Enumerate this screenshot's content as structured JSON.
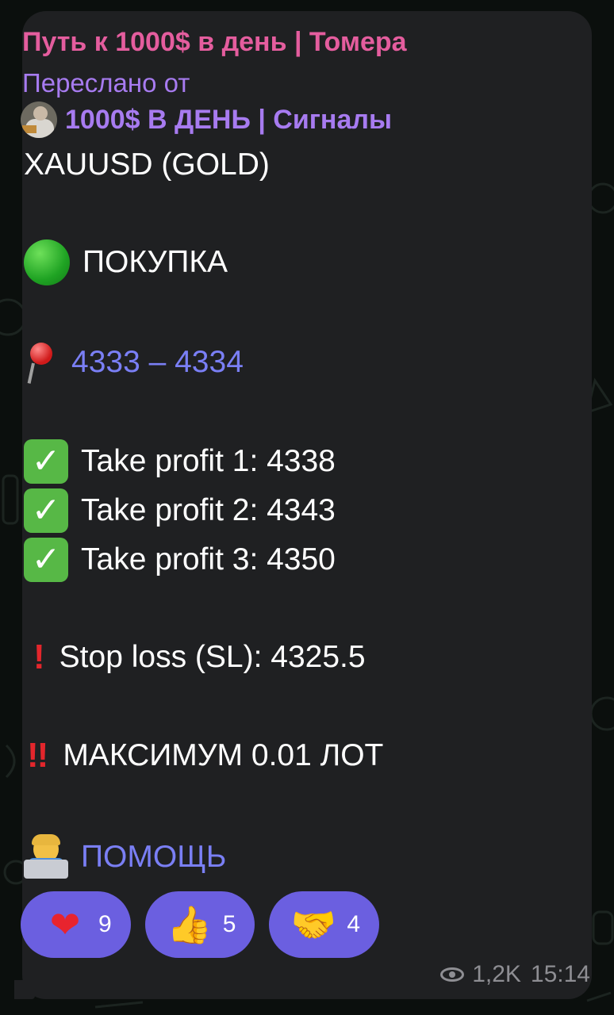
{
  "message": {
    "channel_title": "Путь к 1000$ в день | Томера",
    "forwarded_label": "Переслано от",
    "forwarded_source": "1000$ В ДЕНЬ | Сигналы",
    "instrument": "XAUUSD (GOLD)",
    "direction": "ПОКУПКА",
    "entry_range": "4333 – 4334",
    "take_profits": [
      "Take profit 1: 4338",
      "Take profit 2: 4343",
      "Take profit 3: 4350"
    ],
    "stop_loss": "Stop loss (SL): 4325.5",
    "max_lot": "МАКСИМУМ 0.01 ЛОТ",
    "help_link": "ПОМОЩЬ",
    "reactions": [
      {
        "icon": "heart-icon",
        "glyph": "❤",
        "count": "9"
      },
      {
        "icon": "thumbs-up-icon",
        "glyph": "👍",
        "count": "5"
      },
      {
        "icon": "handshake-icon",
        "glyph": "🤝",
        "count": "4"
      }
    ],
    "views": "1,2K",
    "time": "15:14"
  },
  "colors": {
    "channel_title": "#e45d9e",
    "forwarded": "#a77bf0",
    "link": "#7a7ff5",
    "reaction_chip": "#6b5fe0",
    "bubble": "#1f2022"
  }
}
